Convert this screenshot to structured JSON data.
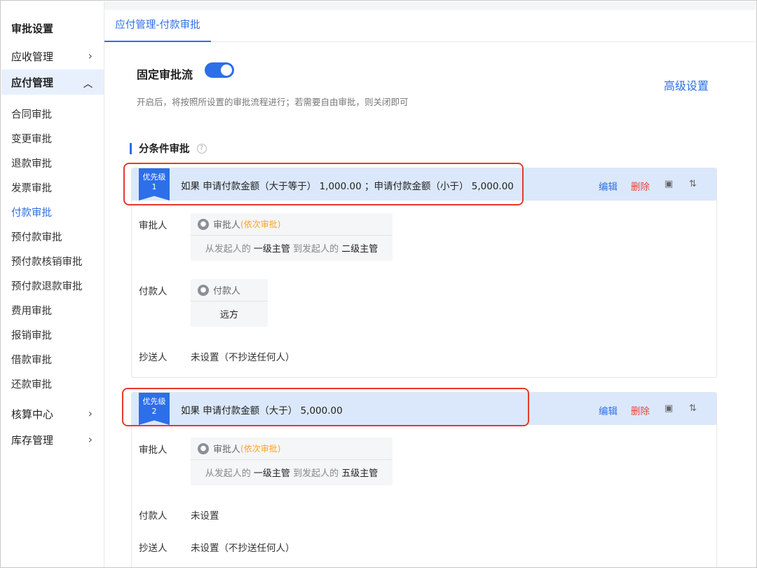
{
  "sidebar": {
    "title": "审批设置",
    "receivable": "应收管理",
    "payable": "应付管理",
    "items": [
      "合同审批",
      "变更审批",
      "退款审批",
      "发票审批",
      "付款审批",
      "预付款审批",
      "预付款核销审批",
      "预付款退款审批",
      "费用审批",
      "报销审批",
      "借款审批",
      "还款审批"
    ],
    "accounting": "核算中心",
    "inventory": "库存管理"
  },
  "tab": "应付管理-付款审批",
  "fixed_flow": {
    "title": "固定审批流",
    "enabled": true,
    "hint": "开启后，将按照所设置的审批流程进行；若需要自由审批，则关闭即可",
    "advanced": "高级设置"
  },
  "section_title": "分条件审批",
  "labels": {
    "approver": "审批人",
    "payer": "付款人",
    "cc": "抄送人",
    "edit": "编辑",
    "delete": "删除"
  },
  "rules": [
    {
      "priority_label": "优先级",
      "priority": "1",
      "condition": "如果 申请付款金额（大于等于） 1,000.00 ；申请付款金额（小于） 5,000.00",
      "approver_title": "审批人",
      "approver_mode": "(依次审批)",
      "approver_from_text": "从发起人的",
      "approver_from": "一级主管",
      "approver_to_text": "到发起人的",
      "approver_to": "二级主管",
      "payer_title": "付款人",
      "payer_value": "远方",
      "cc": "未设置（不抄送任何人）"
    },
    {
      "priority_label": "优先级",
      "priority": "2",
      "condition": "如果 申请付款金额（大于） 5,000.00",
      "approver_title": "审批人",
      "approver_mode": "(依次审批)",
      "approver_from_text": "从发起人的",
      "approver_from": "一级主管",
      "approver_to_text": "到发起人的",
      "approver_to": "五级主管",
      "payer": "未设置",
      "cc": "未设置（不抄送任何人）"
    }
  ],
  "colors": {
    "accent": "#2c6fe8",
    "danger": "#e8453c",
    "highlight": "#e63a2e",
    "header_bg": "#dbe8fb"
  }
}
